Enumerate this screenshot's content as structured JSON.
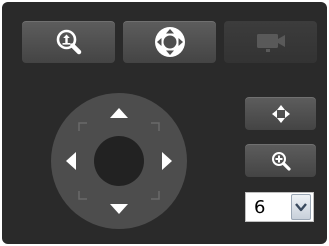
{
  "toolbar": {
    "buttons": [
      {
        "icon": "zoom-in-icon",
        "enabled": true
      },
      {
        "icon": "center-target-icon",
        "enabled": true
      },
      {
        "icon": "camera-icon",
        "enabled": false
      }
    ]
  },
  "dpad": {
    "directions": [
      "up",
      "down",
      "left",
      "right"
    ]
  },
  "side_buttons": [
    {
      "icon": "move-arrows-icon"
    },
    {
      "icon": "zoom-in-icon"
    }
  ],
  "speed_select": {
    "value": "6"
  },
  "colors": {
    "panel": "#2a2a2a",
    "button": "#515151",
    "icon": "#ffffff",
    "disabled_icon": "#5a5a5a"
  }
}
